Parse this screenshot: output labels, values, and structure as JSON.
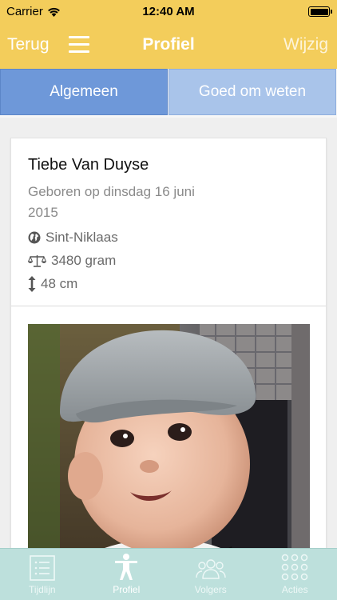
{
  "status_bar": {
    "carrier": "Carrier",
    "time": "12:40 AM",
    "battery_percent": 100
  },
  "nav": {
    "back_label": "Terug",
    "title": "Profiel",
    "edit_label": "Wijzig",
    "menu_icon": "hamburger-menu-icon"
  },
  "tabs": [
    {
      "label": "Algemeen",
      "active": true
    },
    {
      "label": "Goed om weten",
      "active": false
    }
  ],
  "profile": {
    "name": "Tiebe Van Duyse",
    "born_line1": "Geboren op dinsdag 16 juni",
    "born_line2": "2015",
    "place": "Sint-Niklaas",
    "weight": "3480 gram",
    "length": "48 cm"
  },
  "tabbar": [
    {
      "label": "Tijdlijn",
      "icon": "timeline-list-icon",
      "selected": false
    },
    {
      "label": "Profiel",
      "icon": "person-icon",
      "selected": true
    },
    {
      "label": "Volgers",
      "icon": "followers-group-icon",
      "selected": false
    },
    {
      "label": "Acties",
      "icon": "actions-grid-icon",
      "selected": false
    }
  ],
  "colors": {
    "nav_background": "#f3cd5b",
    "tab_active": "#6e98d9",
    "tab_inactive": "#a9c4ea",
    "tabbar_background": "#bde0dc"
  }
}
